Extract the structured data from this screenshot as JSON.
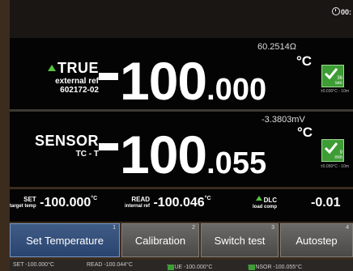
{
  "clock": {
    "text": "00:"
  },
  "true_panel": {
    "indicator": "up-triangle",
    "label": "TRUE",
    "sub1": "external ref",
    "sub2": "602172-02",
    "value_int": "100",
    "value_dec": ".000",
    "secondary": "60.2514Ω",
    "unit": "°C",
    "check_count": "36",
    "check_unit": "sec",
    "tolerance": "±0.030°C - 10m"
  },
  "sensor_panel": {
    "label": "SENSOR",
    "sub1": "TC - T",
    "value_int": "100",
    "value_dec": ".055",
    "secondary": "-3.3803mV",
    "unit": "°C",
    "check_count": "9",
    "check_unit": "min",
    "tolerance": "±0.050°C - 10m"
  },
  "info_bar": {
    "set_label": "SET",
    "set_sub": "target temp",
    "set_value": "-100.000",
    "set_unit": "°C",
    "read_label": "READ",
    "read_sub": "internal ref",
    "read_value": "-100.046",
    "read_unit": "°C",
    "dlc_label": "DLC",
    "dlc_sub": "load comp",
    "dlc_value": "-0.01"
  },
  "tabs": [
    {
      "label": "Set Temperature",
      "num": "1",
      "active": true
    },
    {
      "label": "Calibration",
      "num": "2",
      "active": false
    },
    {
      "label": "Switch test",
      "num": "3",
      "active": false
    },
    {
      "label": "Autostep",
      "num": "4",
      "active": false
    }
  ],
  "status_bar": {
    "set": "SET -100.000°C",
    "read": "READ -100.044°C",
    "true": "TRUE -100.000°C",
    "sensor": "SENSOR -100.055°C"
  },
  "colors": {
    "accent_green": "#3e9c35",
    "tab_active": "#2a4470"
  }
}
